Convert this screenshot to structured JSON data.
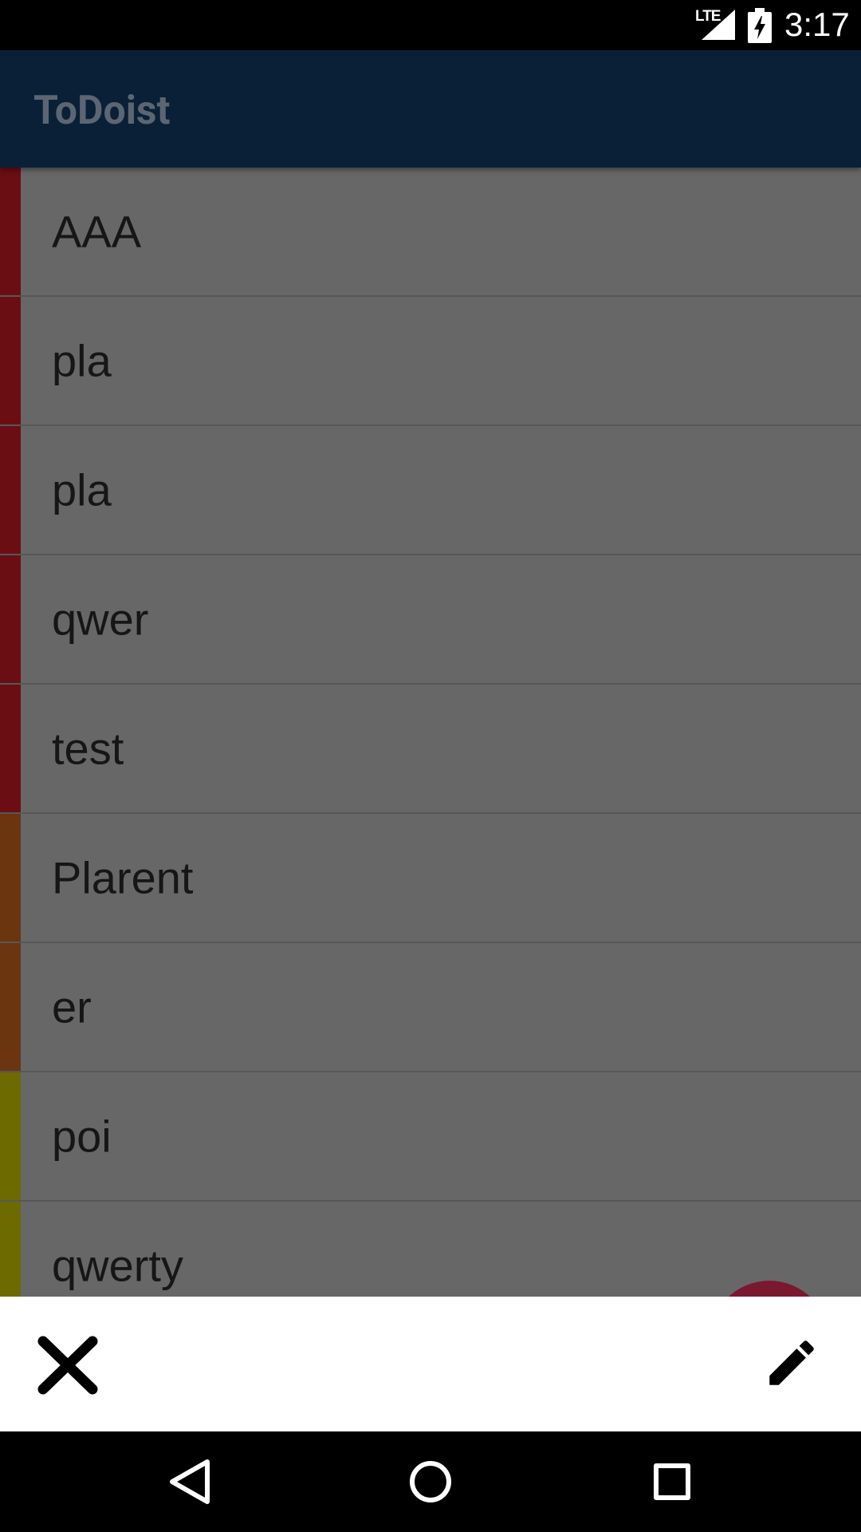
{
  "status_bar": {
    "network": "LTE",
    "time": "3:17"
  },
  "app_bar": {
    "title": "ToDoist"
  },
  "tasks": [
    {
      "label": "AAA",
      "priority_color": "#6a0e14"
    },
    {
      "label": "pla",
      "priority_color": "#6a0e14"
    },
    {
      "label": "pla",
      "priority_color": "#6a0e14"
    },
    {
      "label": "qwer",
      "priority_color": "#6a0e14"
    },
    {
      "label": "test",
      "priority_color": "#6a0e14"
    },
    {
      "label": "Plarent",
      "priority_color": "#6b3510"
    },
    {
      "label": "er",
      "priority_color": "#6b3510"
    },
    {
      "label": "poi",
      "priority_color": "#6d6a00"
    },
    {
      "label": "qwerty",
      "priority_color": "#6d6a00"
    }
  ],
  "action_sheet": {
    "close_icon": "close-icon",
    "edit_icon": "pencil-icon"
  },
  "nav_bar": {
    "back_icon": "back-triangle-icon",
    "home_icon": "home-circle-icon",
    "recents_icon": "recents-square-icon"
  },
  "colors": {
    "app_bar": "#0a2036",
    "fab": "#7a1830"
  }
}
